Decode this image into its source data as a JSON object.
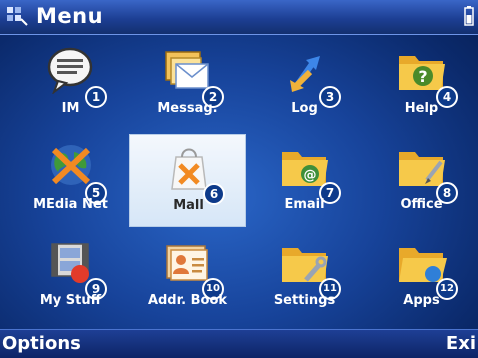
{
  "header": {
    "title": "Menu",
    "title_icon": "menu-grid-icon",
    "status_icon": "battery-icon"
  },
  "apps": [
    {
      "label": "IM",
      "number": "1",
      "icon": "chat-bubble-icon"
    },
    {
      "label": "Messag.",
      "number": "2",
      "icon": "messages-icon"
    },
    {
      "label": "Log",
      "number": "3",
      "icon": "log-arrows-icon"
    },
    {
      "label": "Help",
      "number": "4",
      "icon": "help-folder-icon"
    },
    {
      "label": "MEdia Net",
      "number": "5",
      "icon": "media-net-globe-icon"
    },
    {
      "label": "Mall",
      "number": "6",
      "icon": "mall-bag-icon",
      "selected": true
    },
    {
      "label": "Email",
      "number": "7",
      "icon": "email-folder-icon"
    },
    {
      "label": "Office",
      "number": "8",
      "icon": "office-folder-icon"
    },
    {
      "label": "My Stuff",
      "number": "9",
      "icon": "film-stuff-icon"
    },
    {
      "label": "Addr. Book",
      "number": "10",
      "icon": "address-book-icon"
    },
    {
      "label": "Settings",
      "number": "11",
      "icon": "settings-folder-icon"
    },
    {
      "label": "Apps",
      "number": "12",
      "icon": "apps-folder-icon"
    }
  ],
  "softkeys": {
    "left": "Options",
    "right": "Exi"
  },
  "colors": {
    "accent": "#1d3f94",
    "number_badge": "#0d3a8a",
    "selection": "#e8f0fa"
  }
}
